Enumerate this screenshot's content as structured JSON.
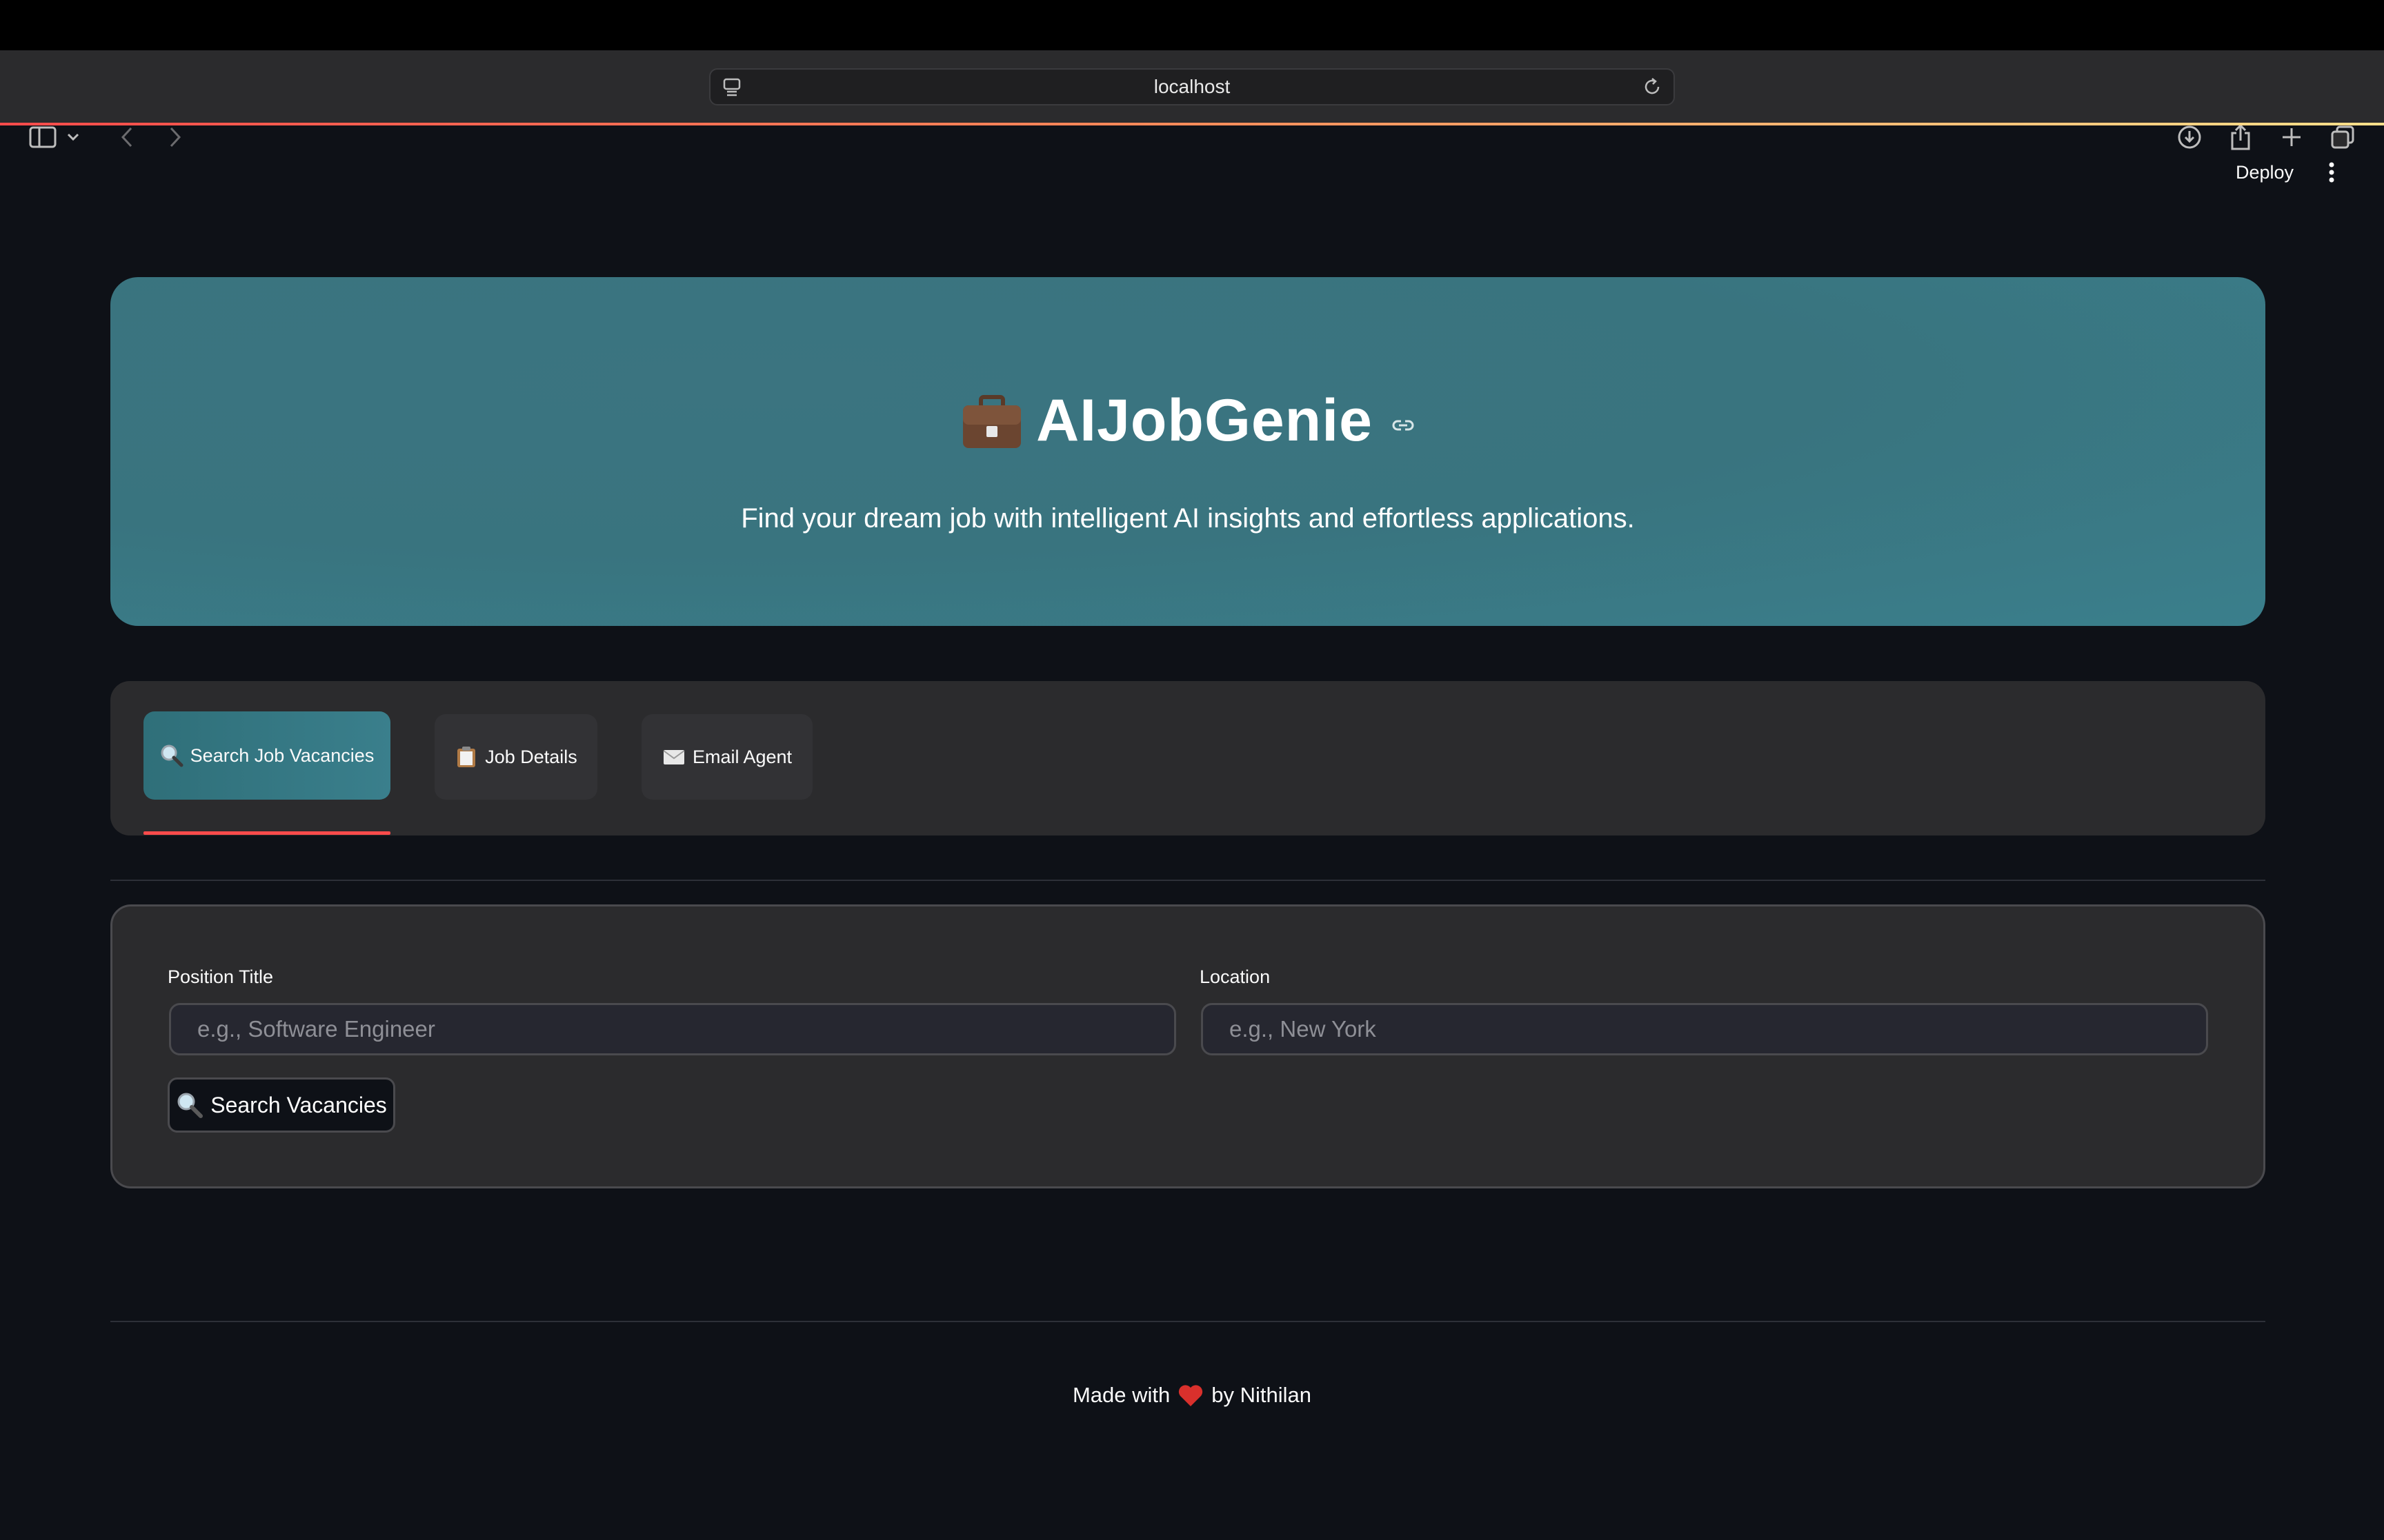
{
  "browser": {
    "url": "localhost",
    "icons": [
      "sidebar-icon",
      "chevron-down-icon",
      "back-icon",
      "forward-icon",
      "reload-icon",
      "download-icon",
      "share-icon",
      "new-tab-icon",
      "tabs-overview-icon"
    ]
  },
  "app_header": {
    "deploy_label": "Deploy",
    "menu_icon": "kebab-menu-icon"
  },
  "hero": {
    "icon": "briefcase-icon",
    "title": "AIJobGenie",
    "subtitle": "Find your dream job with intelligent AI insights and effortless applications."
  },
  "tabs": [
    {
      "label": "Search Job Vacancies",
      "icon": "magnifier-icon",
      "active": true
    },
    {
      "label": "Job Details",
      "icon": "clipboard-icon",
      "active": false
    },
    {
      "label": "Email Agent",
      "icon": "envelope-icon",
      "active": false
    }
  ],
  "form": {
    "position_label": "Position Title",
    "position_placeholder": "e.g., Software Engineer",
    "location_label": "Location",
    "location_placeholder": "e.g., New York",
    "search_button": "Search Vacancies"
  },
  "footer": {
    "text_before": "Made with",
    "text_after": "by Nithilan"
  },
  "colors": {
    "background": "#0e1117",
    "hero": "#39747f",
    "panel": "#2b2b2d",
    "accent": "#ff4b4b"
  }
}
